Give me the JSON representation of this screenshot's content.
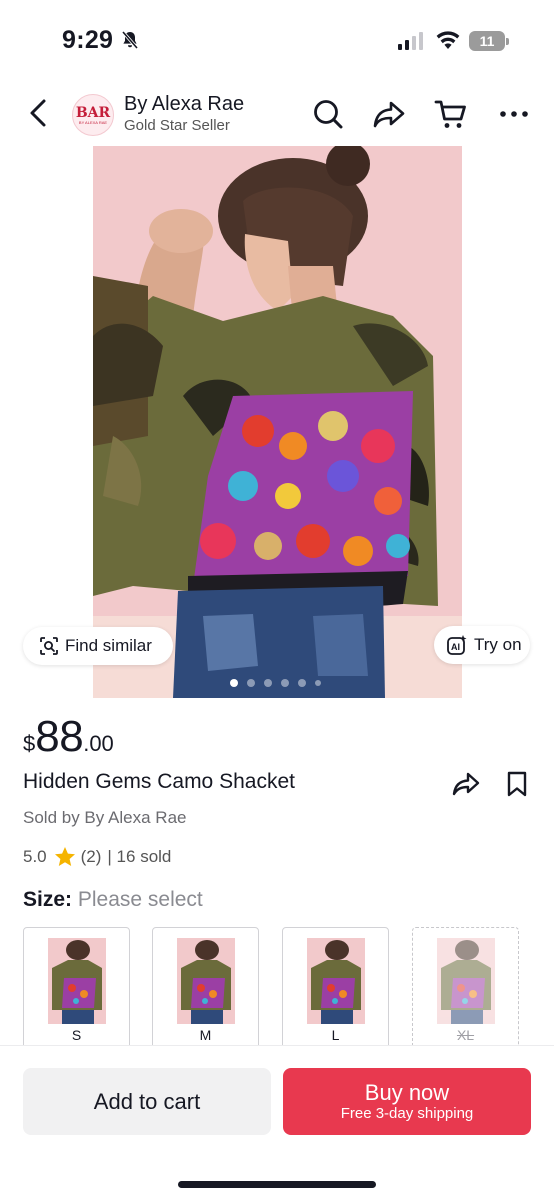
{
  "status_bar": {
    "time": "9:29",
    "battery": "11",
    "icons": [
      "bell-slash-icon",
      "cellular-signal-icon",
      "wifi-icon",
      "battery-icon"
    ]
  },
  "header": {
    "logo_text": "BAR",
    "logo_subtext": "BY ALEXA RAE",
    "seller_name": "By Alexa Rae",
    "seller_badge": "Gold Star Seller",
    "icons": [
      "back-icon",
      "search-icon",
      "share-icon",
      "cart-icon",
      "more-icon"
    ]
  },
  "gallery": {
    "find_similar_label": "Find similar",
    "try_on_label": "Try on",
    "total_images": 6,
    "active_index": 0
  },
  "product": {
    "currency": "$",
    "price_whole": "88",
    "price_decimal": ".00",
    "title": "Hidden Gems Camo Shacket",
    "sold_by": "Sold by By Alexa Rae",
    "rating": "5.0",
    "review_count": "(2)",
    "sold_count": "| 16 sold"
  },
  "size": {
    "label": "Size:",
    "value": "Please select",
    "options": [
      {
        "name": "S",
        "available": true
      },
      {
        "name": "M",
        "available": true
      },
      {
        "name": "L",
        "available": true
      },
      {
        "name": "XL",
        "available": false
      }
    ]
  },
  "bottom_bar": {
    "add_to_cart": "Add to cart",
    "buy_now": "Buy now",
    "shipping_note": "Free 3-day shipping"
  },
  "colors": {
    "accent": "#e8394f",
    "text_primary": "#161823",
    "text_secondary": "#6b6b70",
    "star": "#f5b400",
    "image_background": "#f1c6c9"
  }
}
